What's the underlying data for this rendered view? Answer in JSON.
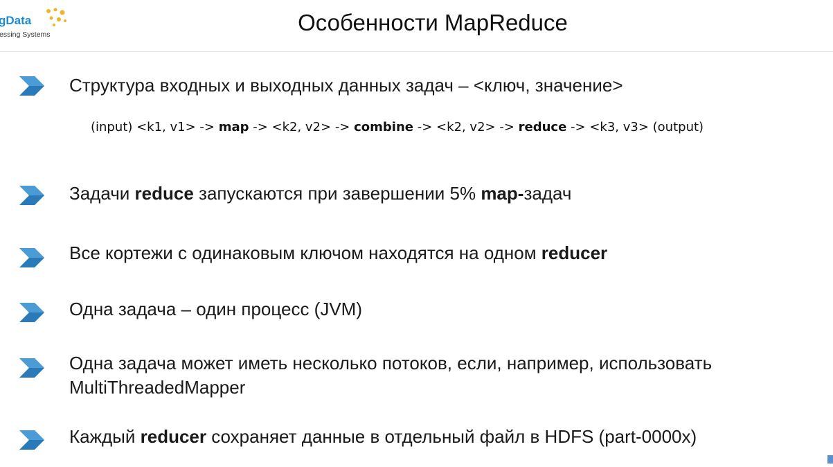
{
  "logo": {
    "word": "gData",
    "subtitle": "essing Systems",
    "dot_color": "#f0b429",
    "word_color": "#1c8bd0"
  },
  "title": "Особенности MapReduce",
  "bullet_icon": "chevron-right-icon",
  "accent_color": "#2a7ab8",
  "bullets": [
    {
      "parts": [
        "Структура входных и выходных данных задач – <ключ, значение>"
      ]
    },
    {
      "parts": [
        "Задачи ",
        "reduce",
        " запускаются при завершении 5% ",
        "map-",
        "задач"
      ]
    },
    {
      "parts": [
        "Все кортежи с одинаковым ключом находятся на одном ",
        "reducer"
      ]
    },
    {
      "parts": [
        "Одна задача – один процесс (JVM)"
      ]
    },
    {
      "parts": [
        "Одна задача может иметь несколько потоков, если, например, использовать MultiThreadedMapper"
      ]
    },
    {
      "parts": [
        "Каждый ",
        "reducer",
        " сохраняет данные в отдельный файл в HDFS (part-0000x)"
      ]
    }
  ],
  "pipeline": {
    "parts": [
      "(input) <k1, v1> -> ",
      "map",
      " -> <k2, v2> -> ",
      "combine",
      " -> <k2, v2> -> ",
      "reduce",
      " -> <k3, v3> (output)"
    ]
  }
}
